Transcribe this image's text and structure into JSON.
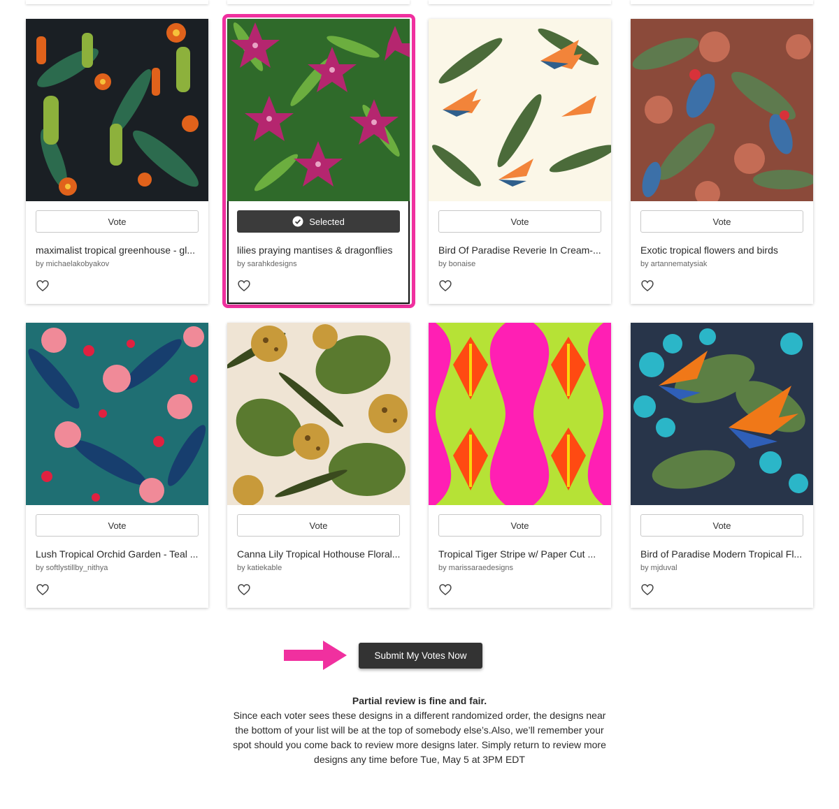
{
  "designs": [
    {
      "title": "maximalist tropical greenhouse - gl...",
      "author": "by michaelakobyakov",
      "vote_label": "Vote",
      "selected": false,
      "palette": [
        "#1a1f24",
        "#e0621b",
        "#8db13c",
        "#2c6b4e"
      ]
    },
    {
      "title": "lilies praying mantises & dragonflies",
      "author": "by sarahkdesigns",
      "vote_label": "Selected",
      "selected": true,
      "palette": [
        "#2f6a2a",
        "#b5266f",
        "#6cae3f",
        "#e8a3c4"
      ]
    },
    {
      "title": "Bird Of Paradise Reverie In Cream-...",
      "author": "by bonaise",
      "vote_label": "Vote",
      "selected": false,
      "palette": [
        "#fbf7e8",
        "#f2843a",
        "#4b6b3a",
        "#2f5f8c"
      ]
    },
    {
      "title": "Exotic tropical flowers and birds",
      "author": "by artannematysiak",
      "vote_label": "Vote",
      "selected": false,
      "palette": [
        "#8b4a3a",
        "#c46c55",
        "#5e7a4e",
        "#3c70a8"
      ]
    },
    {
      "title": "Lush Tropical Orchid Garden - Teal ...",
      "author": "by softlystillby_nithya",
      "vote_label": "Vote",
      "selected": false,
      "palette": [
        "#1f6f73",
        "#f08a98",
        "#e02140",
        "#173e6e"
      ]
    },
    {
      "title": "Canna Lily Tropical Hothouse Floral...",
      "author": "by katiekable",
      "vote_label": "Vote",
      "selected": false,
      "palette": [
        "#efe4d4",
        "#5a7a2f",
        "#c89a3a",
        "#3a4a1e"
      ]
    },
    {
      "title": "Tropical Tiger Stripe w/ Paper Cut ...",
      "author": "by marissaraedesigns",
      "vote_label": "Vote",
      "selected": false,
      "palette": [
        "#ff1fb4",
        "#b6e236",
        "#ff4a12",
        "#f7d80d"
      ]
    },
    {
      "title": "Bird of Paradise Modern Tropical Fl...",
      "author": "by mjduval",
      "vote_label": "Vote",
      "selected": false,
      "palette": [
        "#28354a",
        "#2bb6c8",
        "#f07818",
        "#5c7f44"
      ]
    }
  ],
  "submit": {
    "label": "Submit My Votes Now"
  },
  "note": {
    "title": "Partial review is fine and fair.",
    "body": "Since each voter sees these designs in a different randomized order, the designs near the bottom of your list will be at the top of somebody else’s.Also, we’ll remember your spot should you come back to review more designs later. Simply return to review more designs any time before Tue, May 5 at 3PM EDT"
  },
  "colors": {
    "accent": "#f0309f",
    "button_dark": "#333333"
  },
  "icons": {
    "vote_selected": "check-circle-icon",
    "favorite": "heart-icon",
    "pointer": "arrow-right-icon"
  }
}
